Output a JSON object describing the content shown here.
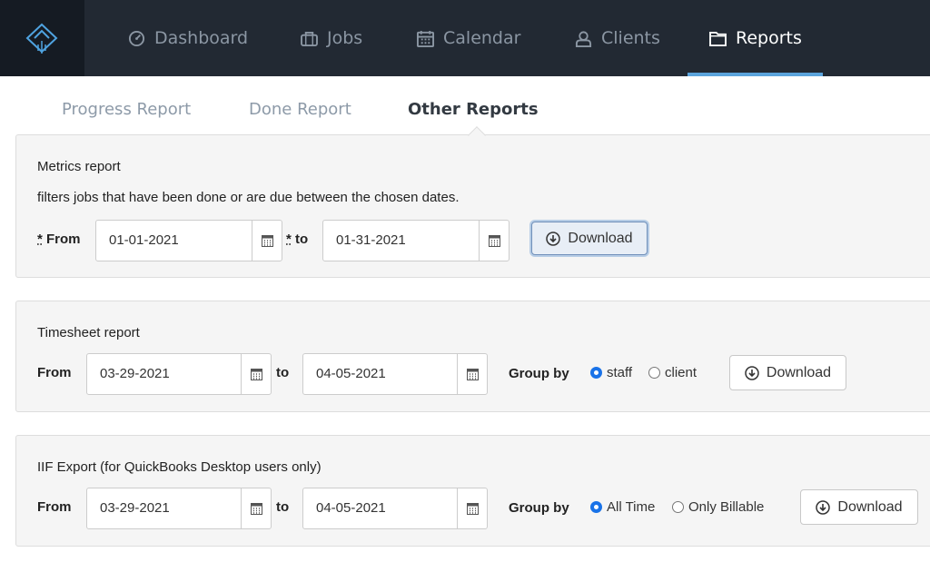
{
  "nav": {
    "items": [
      {
        "label": "Dashboard",
        "icon": "gauge-icon"
      },
      {
        "label": "Jobs",
        "icon": "briefcase-icon"
      },
      {
        "label": "Calendar",
        "icon": "calendar-icon"
      },
      {
        "label": "Clients",
        "icon": "user-icon"
      },
      {
        "label": "Reports",
        "icon": "folder-icon",
        "active": true
      }
    ]
  },
  "subtabs": [
    {
      "label": "Progress Report"
    },
    {
      "label": "Done Report"
    },
    {
      "label": "Other Reports",
      "active": true
    }
  ],
  "metrics": {
    "title": "Metrics report",
    "description": "filters jobs that have been done or are due between the chosen dates.",
    "req_mark": "*",
    "from_label": "From",
    "to_label": "to",
    "from_value": "01-01-2021",
    "to_value": "01-31-2021",
    "download_label": "Download"
  },
  "timesheet": {
    "title": "Timesheet report",
    "from_label": "From",
    "to_label": "to",
    "from_value": "03-29-2021",
    "to_value": "04-05-2021",
    "group_label": "Group by",
    "options": [
      {
        "label": "staff",
        "selected": true
      },
      {
        "label": "client",
        "selected": false
      }
    ],
    "download_label": "Download"
  },
  "iif": {
    "title": "IIF Export (for QuickBooks Desktop users only)",
    "from_label": "From",
    "to_label": "to",
    "from_value": "03-29-2021",
    "to_value": "04-05-2021",
    "group_label": "Group by",
    "options": [
      {
        "label": "All Time",
        "selected": true
      },
      {
        "label": "Only Billable",
        "selected": false
      }
    ],
    "download_label": "Download"
  },
  "colors": {
    "nav_bg": "#222933",
    "accent": "#5ba4dc",
    "radio_selected": "#1a73e8"
  }
}
